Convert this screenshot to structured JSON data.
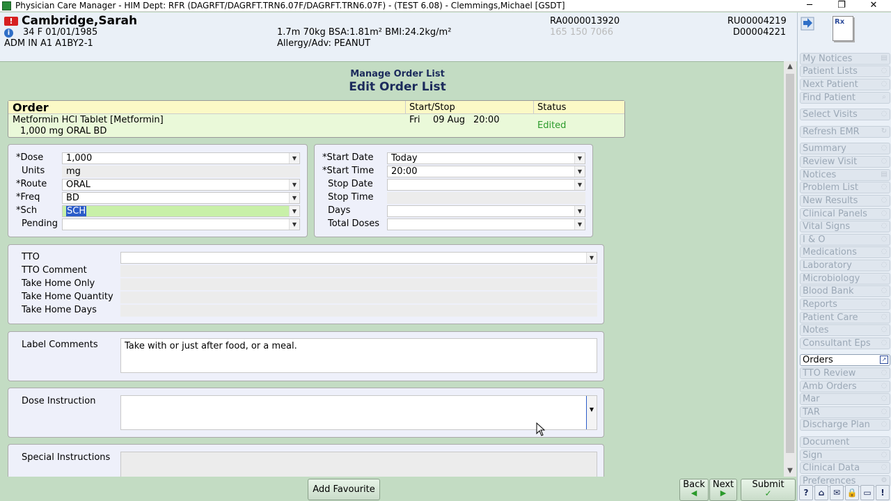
{
  "window": {
    "title": "Physician Care Manager - HIM Dept: RFR (DAGRFT/DAGRFT.TRN6.07F/DAGRFT.TRN6.07F) - (TEST 6.08) - Clemmings,Michael [GSDT]",
    "controls": {
      "minimize": "─",
      "maximize": "❐",
      "close": "✕"
    }
  },
  "patient": {
    "alert_icon": "!",
    "info_icon": "i",
    "name": "Cambridge,Sarah",
    "demographics": "34  F  01/01/1985",
    "location": "ADM IN   A1   A1BY2-1",
    "measurements": "1.7m  70kg  BSA:1.81m²  BMI:24.2kg/m²",
    "allergy": "Allergy/Adv: PEANUT",
    "account_number": "RA0000013920",
    "phone": "165 150 7066",
    "unit_number": "RU00004219",
    "doc_number": "D00004221"
  },
  "page": {
    "subtitle": "Manage Order List",
    "title": "Edit Order List"
  },
  "order_table": {
    "headers": {
      "order": "Order",
      "startstop": "Start/Stop",
      "status": "Status"
    },
    "row": {
      "drug": "Metformin HCl Tablet [Metformin]",
      "dose_line": "1,000 mg ORAL BD",
      "day": "Fri",
      "date": "09 Aug",
      "time": "20:00",
      "status": "Edited"
    }
  },
  "dose_panel": {
    "dose_label": "*Dose",
    "dose_value": "1,000",
    "units_label": "Units",
    "units_value": "mg",
    "route_label": "*Route",
    "route_value": "ORAL",
    "freq_label": "*Freq",
    "freq_value": "BD",
    "sch_label": "*Sch",
    "sch_value": "SCH",
    "pending_label": "Pending",
    "pending_value": ""
  },
  "date_panel": {
    "start_date_label": "*Start Date",
    "start_date_value": "Today",
    "start_time_label": "*Start Time",
    "start_time_value": "20:00",
    "stop_date_label": "Stop Date",
    "stop_date_value": "",
    "stop_time_label": "Stop Time",
    "stop_time_value": "",
    "days_label": "Days",
    "days_value": "",
    "total_doses_label": "Total Doses",
    "total_doses_value": ""
  },
  "tto_panel": {
    "tto_label": "TTO",
    "tto_comment_label": "TTO Comment",
    "take_home_only_label": "Take Home Only",
    "take_home_quantity_label": "Take Home Quantity",
    "take_home_days_label": "Take Home Days"
  },
  "label_comments": {
    "label": "Label Comments",
    "value": "Take with or just after food, or a meal."
  },
  "dose_instruction": {
    "label": "Dose Instruction",
    "value": ""
  },
  "special_instructions": {
    "label": "Special Instructions",
    "value": ""
  },
  "sidebar": {
    "rx_icon": "Rx",
    "items": [
      {
        "label": "My Notices",
        "icon": "notice-icon"
      },
      {
        "label": "Patient Lists",
        "icon": "list-icon"
      },
      {
        "label": "Next Patient",
        "icon": "next-icon"
      },
      {
        "label": "Find Patient",
        "icon": "search-icon"
      },
      {
        "label": "Select Visits",
        "icon": "visits-icon"
      },
      {
        "label": "Refresh EMR",
        "icon": "refresh-icon"
      },
      {
        "label": "Summary",
        "icon": "summary-icon"
      },
      {
        "label": "Review Visit",
        "icon": "review-icon"
      },
      {
        "label": "Notices",
        "icon": "notice-icon"
      },
      {
        "label": "Problem List",
        "icon": "problem-icon"
      },
      {
        "label": "New Results",
        "icon": "results-icon"
      },
      {
        "label": "Clinical Panels",
        "icon": "panels-icon"
      },
      {
        "label": "Vital Signs",
        "icon": "vitals-icon"
      },
      {
        "label": "I & O",
        "icon": "io-icon"
      },
      {
        "label": "Medications",
        "icon": "medications-icon"
      },
      {
        "label": "Laboratory",
        "icon": "lab-icon"
      },
      {
        "label": "Microbiology",
        "icon": "micro-icon"
      },
      {
        "label": "Blood Bank",
        "icon": "blood-icon"
      },
      {
        "label": "Reports",
        "icon": "reports-icon"
      },
      {
        "label": "Patient Care",
        "icon": "care-icon"
      },
      {
        "label": "Notes",
        "icon": "notes-icon"
      },
      {
        "label": "Consultant Eps",
        "icon": "consultant-icon"
      },
      {
        "label": "Orders",
        "icon": "orders-icon"
      },
      {
        "label": "TTO Review",
        "icon": "tto-icon"
      },
      {
        "label": "Amb Orders",
        "icon": "amb-icon"
      },
      {
        "label": "Mar",
        "icon": "mar-icon"
      },
      {
        "label": "TAR",
        "icon": "tar-icon"
      },
      {
        "label": "Discharge Plan",
        "icon": "discharge-icon"
      },
      {
        "label": "Document",
        "icon": "document-icon"
      },
      {
        "label": "Sign",
        "icon": "sign-icon"
      },
      {
        "label": "Clinical Data",
        "icon": "data-icon"
      },
      {
        "label": "Preferences",
        "icon": "gear-icon"
      }
    ]
  },
  "buttons": {
    "add_favourite": "Add Favourite",
    "back": "Back",
    "next": "Next",
    "submit": "Submit"
  },
  "tools": [
    "?",
    "⌂",
    "✉",
    "🔒",
    "▭",
    "!"
  ],
  "colors": {
    "background": "#c3dcc3",
    "banner": "#eaf0f7",
    "panel": "#eef0fa",
    "status_edited": "#2a9a2a",
    "selection": "#2b5cc8"
  }
}
